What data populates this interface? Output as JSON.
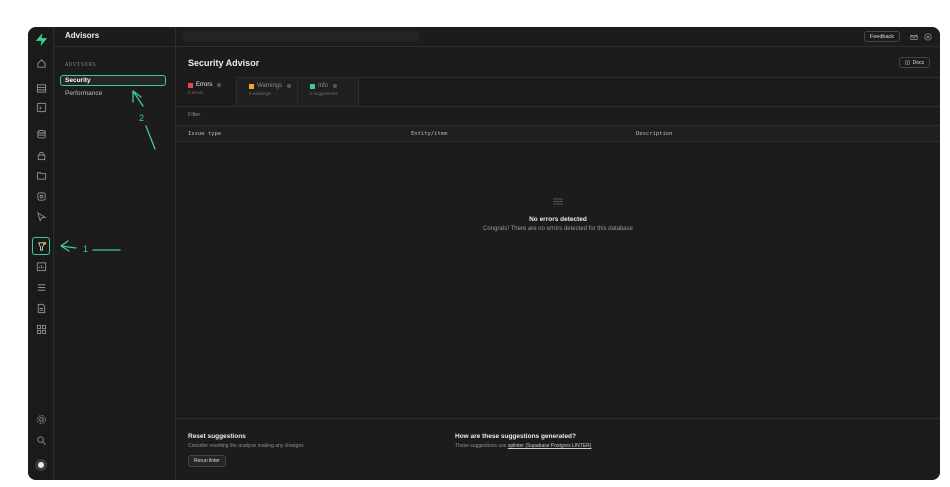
{
  "sidebar": {
    "title": "Advisors",
    "section_label": "ADVISORS",
    "items": [
      {
        "label": "Security",
        "active": true
      },
      {
        "label": "Performance",
        "active": false
      }
    ]
  },
  "rail": {
    "icons": [
      "home-icon",
      "table-editor-icon",
      "sql-editor-icon",
      "database-icon",
      "auth-icon",
      "storage-icon",
      "edge-functions-icon",
      "realtime-icon",
      "advisors-icon",
      "reports-icon",
      "logs-icon",
      "api-docs-icon",
      "integrations-icon",
      "settings-icon",
      "search-icon",
      "avatar"
    ]
  },
  "topbar": {
    "feedback_label": "Feedback"
  },
  "page": {
    "title": "Security Advisor",
    "docs_label": "Docs"
  },
  "tabs": [
    {
      "label": "Errors",
      "sub": "0 errors",
      "color": "#e5484d",
      "active": true
    },
    {
      "label": "Warnings",
      "sub": "0 warnings",
      "color": "#f5a524",
      "active": false
    },
    {
      "label": "Info",
      "sub": "0 suggestions",
      "color": "#3ecf8e",
      "active": false
    }
  ],
  "filter": {
    "placeholder": "Filter"
  },
  "table": {
    "columns": [
      "Issue type",
      "Entity/item",
      "Description"
    ]
  },
  "empty_state": {
    "title": "No errors detected",
    "description": "Congrats! There are no errors detected for this database"
  },
  "footer": {
    "reset_title": "Reset suggestions",
    "reset_desc": "Consider resetting the analysis making any changes",
    "rerun_label": "Rerun linter",
    "how_title": "How are these suggestions generated?",
    "how_desc_prefix": "These suggestions use",
    "how_desc_link": "splinter (Supabase Postgres LINTER)"
  },
  "annotations": {
    "arrow1_label": "1",
    "arrow2_label": "2",
    "color": "#3ecf8e"
  },
  "colors": {
    "accent": "#3ecf8e",
    "background": "#1c1c1c"
  }
}
